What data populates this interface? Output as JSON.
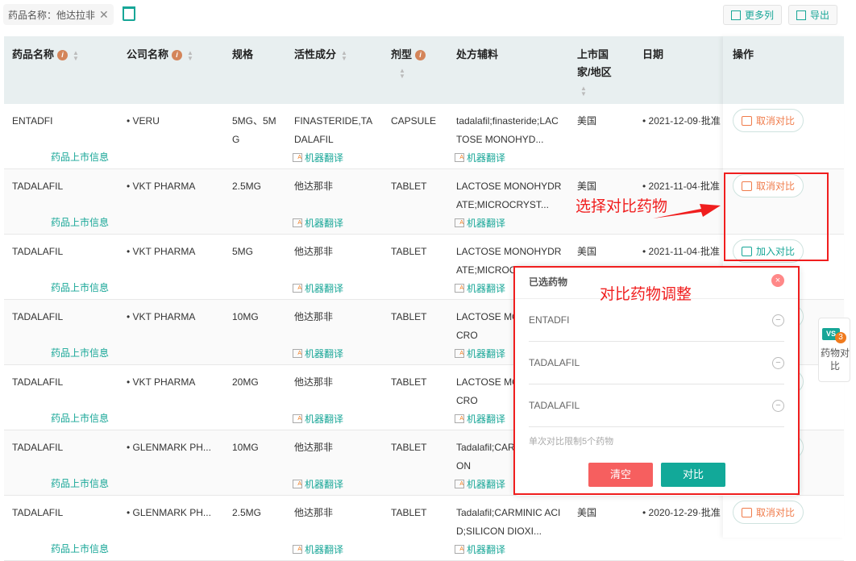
{
  "filter": {
    "label": "药品名称：他达拉非"
  },
  "toolbar": {
    "more_columns": "更多列",
    "export": "导出"
  },
  "columns": [
    "药品名称",
    "公司名称",
    "规格",
    "活性成分",
    "剂型",
    "处方辅料",
    "上市国家/地区",
    "日期",
    "操作"
  ],
  "link_label": "药品上市信息",
  "translate_label": "机器翻译",
  "rows": [
    {
      "name": "ENTADFI",
      "company": "VERU",
      "spec": "5MG、5MG",
      "active": "FINASTERIDE,TADALAFIL",
      "form": "CAPSULE",
      "excipient": "tadalafil;finasteride;LACTOSE MONOHYD...",
      "country": "美国",
      "date": "2021-12-09·批准",
      "action": "取消对比",
      "action_type": "cancel"
    },
    {
      "name": "TADALAFIL",
      "company": "VKT PHARMA",
      "spec": "2.5MG",
      "active": "他达那非",
      "form": "TABLET",
      "excipient": "LACTOSE MONOHYDRATE;MICROCRYST...",
      "country": "美国",
      "date": "2021-11-04·批准",
      "action": "取消对比",
      "action_type": "cancel"
    },
    {
      "name": "TADALAFIL",
      "company": "VKT PHARMA",
      "spec": "5MG",
      "active": "他达那非",
      "form": "TABLET",
      "excipient": "LACTOSE MONOHYDRATE;MICROC",
      "country": "美国",
      "date": "2021-11-04·批准",
      "action": "加入对比",
      "action_type": "add"
    },
    {
      "name": "TADALAFIL",
      "company": "VKT PHARMA",
      "spec": "10MG",
      "active": "他达那非",
      "form": "TABLET",
      "excipient": "LACTOSE MORATE;MICRO",
      "country": "",
      "date": "",
      "action": "",
      "action_type": "none"
    },
    {
      "name": "TADALAFIL",
      "company": "VKT PHARMA",
      "spec": "20MG",
      "active": "他达那非",
      "form": "TABLET",
      "excipient": "LACTOSE MORATE;MICRO",
      "country": "",
      "date": "",
      "action": "",
      "action_type": "none"
    },
    {
      "name": "TADALAFIL",
      "company": "GLENMARK PH...",
      "spec": "10MG",
      "active": "他达那非",
      "form": "TABLET",
      "excipient": "Tadalafil;CARCID;SILICON",
      "country": "",
      "date": "",
      "action": "",
      "action_type": "none"
    },
    {
      "name": "TADALAFIL",
      "company": "GLENMARK PH...",
      "spec": "2.5MG",
      "active": "他达那非",
      "form": "TABLET",
      "excipient": "Tadalafil;CARMINIC ACID;SILICON DIOXI...",
      "country": "美国",
      "date": "2020-12-29·批准",
      "action": "取消对比",
      "action_type": "cancel"
    }
  ],
  "annotations": {
    "select": "选择对比药物",
    "adjust": "对比药物调整"
  },
  "popup": {
    "title": "已选药物",
    "items": [
      "ENTADFI",
      "TADALAFIL",
      "TADALAFIL"
    ],
    "limit": "单次对比限制5个药物",
    "clear": "清空",
    "compare": "对比"
  },
  "float": {
    "vs": "VS",
    "count": "3",
    "label": "药物对比"
  },
  "colors": {
    "accent": "#17a697",
    "cancel": "#f07b4a",
    "danger": "#f05a5a",
    "annotation": "#f01e1e"
  }
}
